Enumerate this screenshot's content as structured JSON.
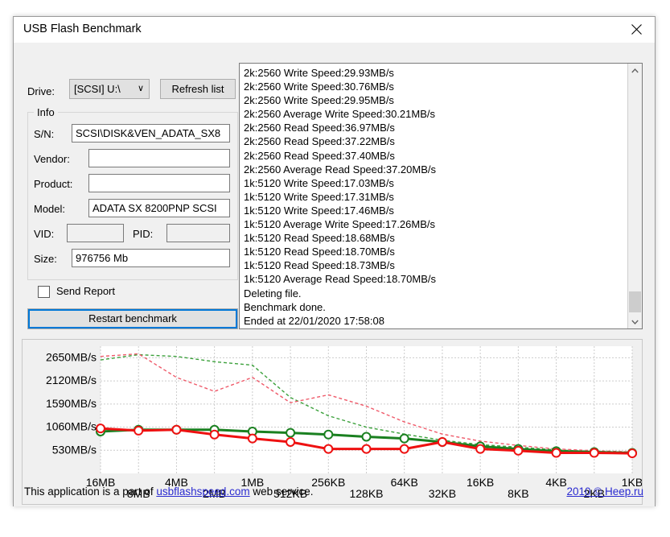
{
  "window": {
    "title": "USB Flash Benchmark",
    "close_icon": "close-icon"
  },
  "toolbar": {
    "drive_label": "Drive:",
    "drive_value": "[SCSI] U:\\",
    "drive_chevron": "∨",
    "refresh_label": "Refresh list"
  },
  "info": {
    "legend": "Info",
    "sn_label": "S/N:",
    "sn_value": "SCSI\\DISK&VEN_ADATA_SX8",
    "vendor_label": "Vendor:",
    "vendor_value": "",
    "product_label": "Product:",
    "product_value": "",
    "model_label": "Model:",
    "model_value": "ADATA SX 8200PNP SCSI",
    "vid_label": "VID:",
    "vid_value": "",
    "pid_label": "PID:",
    "pid_value": "",
    "size_label": "Size:",
    "size_value": "976756 Mb"
  },
  "actions": {
    "send_report_label": "Send Report",
    "send_report_checked": false,
    "restart_label": "Restart benchmark"
  },
  "log": {
    "scroll_up_icon": "chevron-up-icon",
    "scroll_down_icon": "chevron-down-icon",
    "lines": [
      "2k:2560 Write Speed:29.93MB/s",
      "2k:2560 Write Speed:30.76MB/s",
      "2k:2560 Write Speed:29.95MB/s",
      "2k:2560 Average Write Speed:30.21MB/s",
      "2k:2560 Read Speed:36.97MB/s",
      "2k:2560 Read Speed:37.22MB/s",
      "2k:2560 Read Speed:37.40MB/s",
      "2k:2560 Average Read Speed:37.20MB/s",
      "1k:5120 Write Speed:17.03MB/s",
      "1k:5120 Write Speed:17.31MB/s",
      "1k:5120 Write Speed:17.46MB/s",
      "1k:5120 Average Write Speed:17.26MB/s",
      "1k:5120 Read Speed:18.68MB/s",
      "1k:5120 Read Speed:18.70MB/s",
      "1k:5120 Read Speed:18.73MB/s",
      "1k:5120 Average Read Speed:18.70MB/s",
      "Deleting file.",
      "Benchmark done.",
      "Ended at 22/01/2020 17:58:08"
    ]
  },
  "status": {
    "text_before": "This application is a part of ",
    "link_text": "usbflashspeed.com",
    "text_after": " web service.",
    "copyright": "2010 © Heep.ru"
  },
  "colors": {
    "read_solid": "#1a8020",
    "write_solid": "#ee1111",
    "read_dashed": "#3aa03a",
    "write_dashed": "#ef5a6a",
    "grid": "#cccccc",
    "plot_bg": "#ffffff",
    "panel_bg": "#f0f0f0",
    "accent": "#0078d7",
    "link": "#2a2ad0"
  },
  "chart_data": {
    "type": "line",
    "title": "",
    "xlabel": "",
    "ylabel": "",
    "grid": true,
    "legend": "none",
    "ylim": [
      0,
      2915
    ],
    "ytick_labels": [
      "530MB/s",
      "1060MB/s",
      "1590MB/s",
      "2120MB/s",
      "2650MB/s"
    ],
    "ytick_values": [
      530,
      1060,
      1590,
      2120,
      2650
    ],
    "categories": [
      "16MB",
      "8MB",
      "4MB",
      "2MB",
      "1MB",
      "512KB",
      "256KB",
      "128KB",
      "64KB",
      "32KB",
      "16KB",
      "8KB",
      "4KB",
      "2KB",
      "1KB"
    ],
    "series": [
      {
        "name": "read-speed-solid",
        "style": "solid",
        "color": "#1a8020",
        "values": [
          960,
          1000,
          1000,
          1000,
          960,
          930,
          890,
          840,
          800,
          720,
          620,
          560,
          510,
          490,
          470
        ]
      },
      {
        "name": "write-speed-solid",
        "style": "solid",
        "color": "#ee1111",
        "values": [
          1030,
          980,
          1000,
          890,
          800,
          720,
          560,
          560,
          560,
          720,
          560,
          520,
          470,
          470,
          460
        ]
      },
      {
        "name": "read-dashed",
        "style": "dashed",
        "color": "#3aa03a",
        "values": [
          2600,
          2720,
          2680,
          2560,
          2480,
          1740,
          1320,
          1060,
          900,
          760,
          660,
          600,
          540,
          500,
          480
        ]
      },
      {
        "name": "write-dashed",
        "style": "dashed",
        "color": "#ef5a6a",
        "values": [
          2680,
          2740,
          2200,
          1880,
          2200,
          1620,
          1800,
          1540,
          1180,
          900,
          740,
          640,
          560,
          520,
          490
        ]
      }
    ]
  }
}
